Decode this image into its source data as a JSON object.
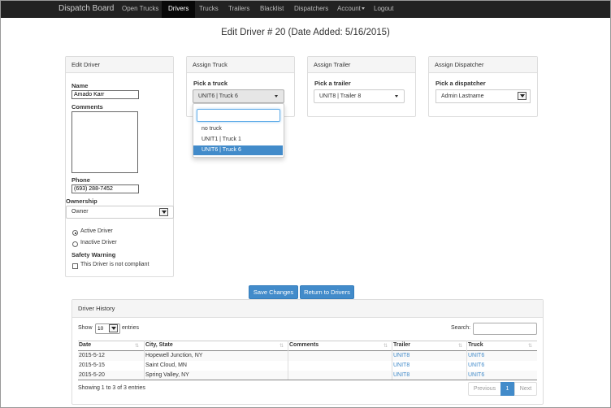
{
  "navbar": {
    "brand": "Dispatch Board",
    "items": [
      {
        "label": "Open Trucks"
      },
      {
        "label": "Drivers"
      },
      {
        "label": "Trucks"
      },
      {
        "label": "Trailers"
      },
      {
        "label": "Blacklist"
      },
      {
        "label": "Dispatchers"
      },
      {
        "label": "Account"
      },
      {
        "label": "Logout"
      }
    ],
    "active_item": "Drivers"
  },
  "page": {
    "title": "Edit Driver # 20 (Date Added: 5/16/2015)"
  },
  "edit_driver": {
    "heading": "Edit Driver",
    "name_label": "Name",
    "name_value": "Amado Karr",
    "comments_label": "Comments",
    "comments_value": "",
    "phone_label": "Phone",
    "phone_value": "(693) 288-7452",
    "ownership_label": "Ownership",
    "ownership_value": "Owner",
    "active_driver_label": "Active Driver",
    "inactive_driver_label": "Inactive Driver",
    "status_selected": "Active Driver",
    "safety_warning_label": "Safety Warning",
    "not_compliant_label": "This Driver is not compliant",
    "not_compliant_checked": false
  },
  "assign_truck": {
    "heading": "Assign Truck",
    "pick_label": "Pick a truck",
    "selected": "UNIT6 | Truck 6",
    "search_value": "",
    "options": [
      "no truck",
      "UNIT1 | Truck 1",
      "UNIT6 | Truck 6"
    ],
    "highlighted_option": "UNIT6 | Truck 6"
  },
  "assign_trailer": {
    "heading": "Assign Trailer",
    "pick_label": "Pick a trailer",
    "selected": "UNIT8 | Trailer 8"
  },
  "assign_dispatcher": {
    "heading": "Assign Dispatcher",
    "pick_label": "Pick a dispatcher",
    "selected": "Admin Lastname"
  },
  "actions": {
    "save_label": "Save Changes",
    "return_label": "Return to Drivers"
  },
  "history": {
    "heading": "Driver History",
    "show_label": "Show",
    "page_size": "10",
    "entries_label": "entries",
    "search_label": "Search:",
    "search_value": "",
    "columns": [
      "Date",
      "City, State",
      "Comments",
      "Trailer",
      "Truck"
    ],
    "rows": [
      [
        "2015-5-12",
        "Hopewell Junction, NY",
        "",
        "UNIT8",
        "UNIT6"
      ],
      [
        "2015-5-15",
        "Saint Cloud, MN",
        "",
        "UNIT8",
        "UNIT6"
      ],
      [
        "2015-5-20",
        "Spring Valley, NY",
        "",
        "UNIT8",
        "UNIT6"
      ]
    ],
    "info": "Showing 1 to 3 of 3 entries",
    "pagination": {
      "previous": "Previous",
      "current": "1",
      "next": "Next"
    }
  },
  "colors": {
    "navbar_bg": "#222222",
    "primary": "#428bca",
    "panel_heading_bg": "#f5f5f5"
  }
}
